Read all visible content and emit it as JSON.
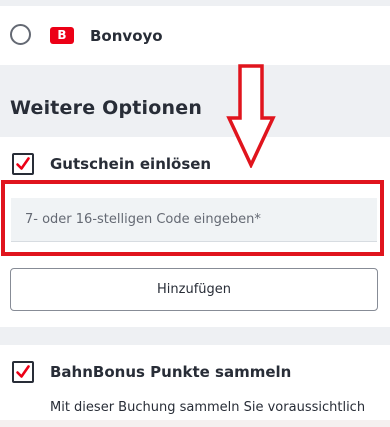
{
  "payment_option": {
    "logo_text": "B",
    "label": "Bonvoyo",
    "brand_color": "#ec0016"
  },
  "section": {
    "title": "Weitere Optionen"
  },
  "voucher": {
    "checkbox_checked": true,
    "label": "Gutschein einlösen",
    "input_placeholder": "7- oder 16-stelligen Code eingeben*",
    "input_value": "",
    "add_button_label": "Hinzufügen"
  },
  "bahnbonus": {
    "checkbox_checked": true,
    "label": "BahnBonus Punkte sammeln",
    "description": "Mit dieser Buchung sammeln Sie voraussichtlich"
  },
  "colors": {
    "accent_red": "#ec0016",
    "annotation_red": "#e0141d",
    "text": "#282d37",
    "background": "#eef0f3"
  },
  "icons": {
    "checkmark": "checkmark-icon",
    "annotation_arrow": "down-arrow-icon",
    "radio": "radio-icon"
  }
}
